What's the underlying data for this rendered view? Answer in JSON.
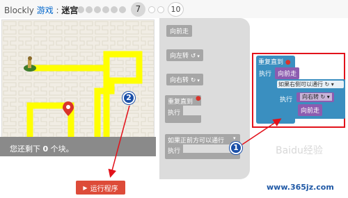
{
  "header": {
    "app_name": "Blockly",
    "game_name": "游戏",
    "separator": " : ",
    "level_name": "迷宫",
    "current_level": "7",
    "last_level": "10"
  },
  "maze": {
    "blocks_left_prefix": "您还剩下 ",
    "blocks_left_count": "0",
    "blocks_left_suffix": " 个块。"
  },
  "run_button": {
    "label": "运行程序"
  },
  "toolbox": {
    "move_forward": "向前走",
    "turn_left": "向左转 ↺",
    "turn_right": "向右转 ↻",
    "repeat_until": "重复直到",
    "do_label": "执行",
    "if_path_ahead": "如果正前方可以通行",
    "if_do_label": "执行"
  },
  "workspace": {
    "repeat_until": "重复直到",
    "do_label": "执行",
    "move_forward_1": "向前走",
    "if_path_right": "如果右侧可以通行 ↻",
    "if_do_label": "执行",
    "turn_right_label": "向右转 ↻",
    "move_forward_2": "向前走"
  },
  "callouts": {
    "one": "1",
    "two": "2"
  },
  "watermark": "Baidu经验",
  "site_url": "www.365jz.com",
  "colors": {
    "path": "#ffff00",
    "run_button": "#dd4b39",
    "loop_block": "#3a8fc0",
    "action_block": "#8c5cb0",
    "highlight": "#e2121b",
    "callout": "#1a4fa8"
  }
}
